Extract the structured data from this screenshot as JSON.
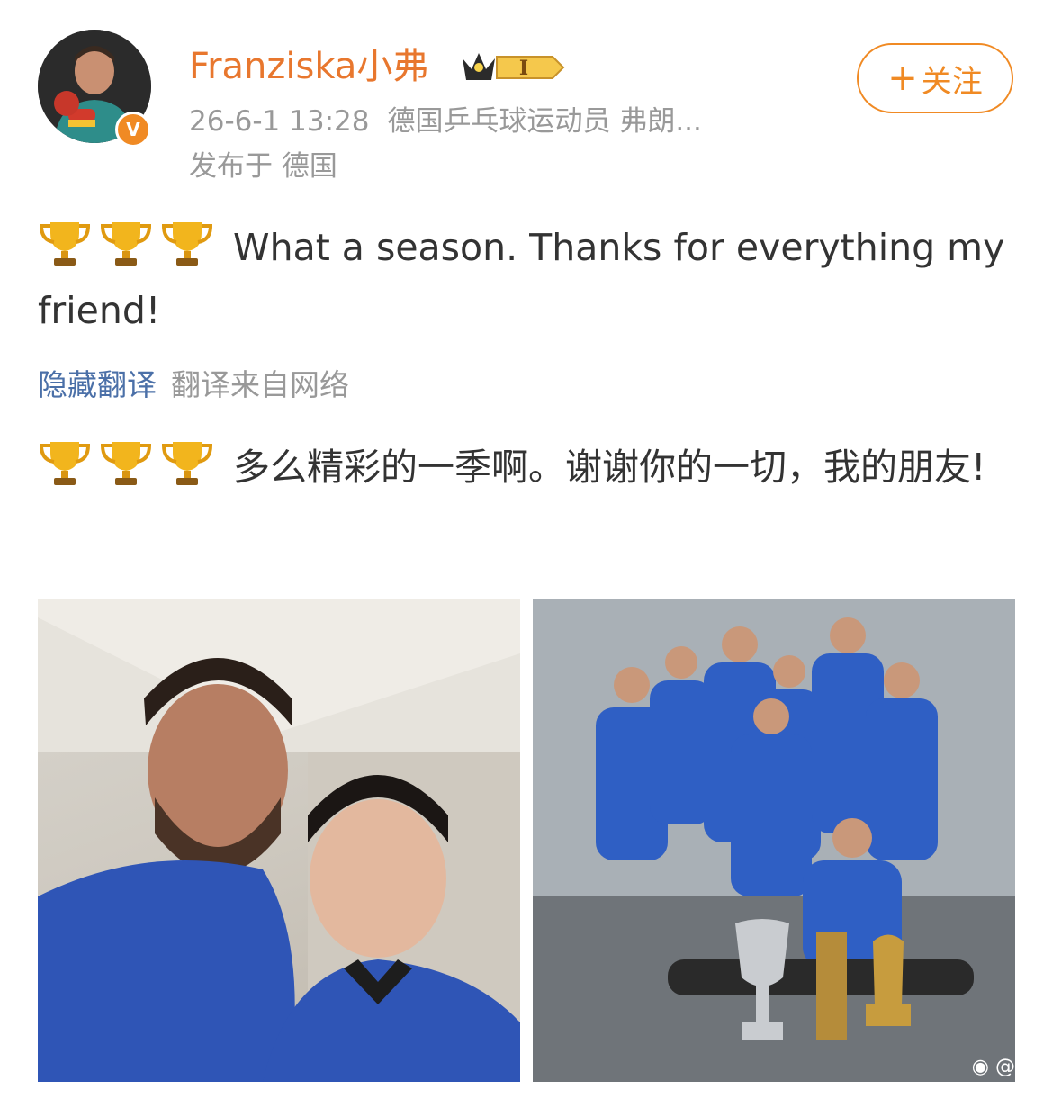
{
  "post": {
    "username": "Franziska小弗",
    "vip_level": "I",
    "follow_label": "关注",
    "follow_icon": "plus-icon",
    "timestamp": "26-6-1 13:28",
    "source": "德国乒乓球运动员 弗朗...",
    "location": "发布于 德国",
    "verified_icon": "verified-v-icon",
    "verified_mark": "V",
    "text_original": "What a season. Thanks for everything my friend!",
    "translate_toggle": "隐藏翻译",
    "translate_source": "翻译来自网络",
    "text_translated": "多么精彩的一季啊。谢谢你的一切，我的朋友!",
    "trophy_icon": "trophy-icon",
    "trophy_count": 3,
    "watermark": "@"
  },
  "colors": {
    "accent": "#f08a24",
    "username": "#e8772e",
    "link": "#4b70a8",
    "muted": "#999999",
    "text": "#333333"
  }
}
